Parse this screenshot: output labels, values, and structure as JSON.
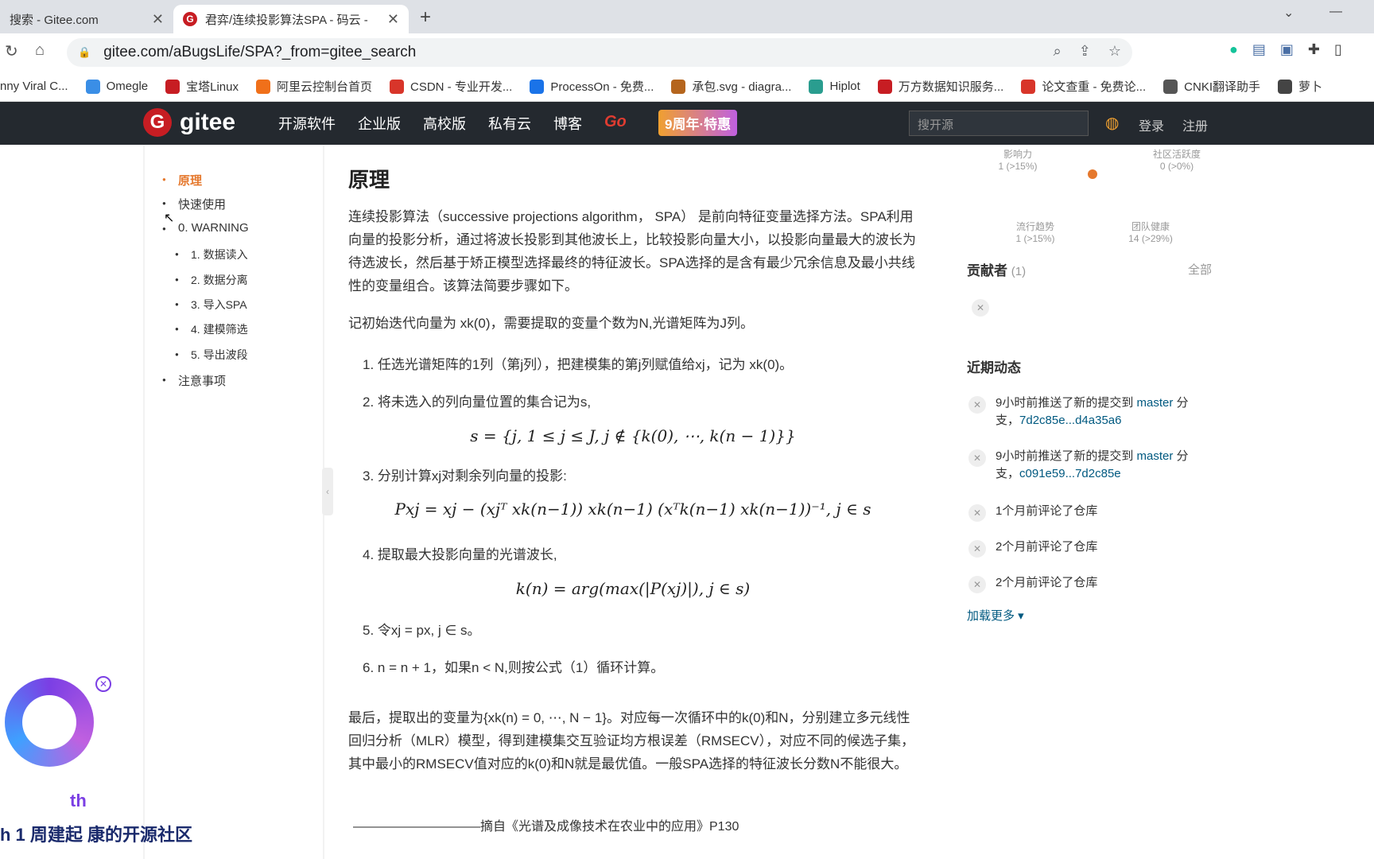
{
  "browser": {
    "tabs": [
      {
        "title": "搜索 - Gitee.com"
      },
      {
        "title": "君弈/连续投影算法SPA - 码云 -"
      }
    ],
    "url": "gitee.com/aBugsLife/SPA?_from=gitee_search",
    "bookmarks": [
      {
        "label": "nny Viral C...",
        "color": "#888"
      },
      {
        "label": "Omegle",
        "color": "#3a8ee6"
      },
      {
        "label": "宝塔Linux",
        "color": "#c71d23"
      },
      {
        "label": "阿里云控制台首页",
        "color": "#f0701a"
      },
      {
        "label": "CSDN - 专业开发...",
        "color": "#d8352a"
      },
      {
        "label": "ProcessOn - 免费...",
        "color": "#1a73e8"
      },
      {
        "label": "承包.svg - diagra...",
        "color": "#b5651d"
      },
      {
        "label": "Hiplot",
        "color": "#2a9d8f"
      },
      {
        "label": "万方数据知识服务...",
        "color": "#c71d23"
      },
      {
        "label": "论文查重 - 免费论...",
        "color": "#d8352a"
      },
      {
        "label": "CNKI翻译助手",
        "color": "#555"
      },
      {
        "label": "萝卜",
        "color": "#444"
      }
    ]
  },
  "gitee_nav": {
    "logo": "gitee",
    "menu": [
      "开源软件",
      "企业版",
      "高校版",
      "私有云",
      "博客"
    ],
    "go": "Go",
    "promo": "9周年·特惠",
    "search_placeholder": "搜开源",
    "login": "登录",
    "register": "注册"
  },
  "toc": {
    "items": [
      {
        "label": "原理",
        "level": 1,
        "active": true
      },
      {
        "label": "快速使用",
        "level": 1
      },
      {
        "label": "0. WARNING",
        "level": 1
      },
      {
        "label": "1. 数据读入",
        "level": 2
      },
      {
        "label": "2. 数据分离",
        "level": 2
      },
      {
        "label": "3. 导入SPA",
        "level": 2
      },
      {
        "label": "4. 建模筛选",
        "level": 2
      },
      {
        "label": "5. 导出波段",
        "level": 2
      },
      {
        "label": "注意事项",
        "level": 1
      }
    ]
  },
  "article": {
    "title": "原理",
    "intro": "连续投影算法（successive projections algorithm， SPA） 是前向特征变量选择方法。SPA利用向量的投影分析，通过将波长投影到其他波长上，比较投影向量大小，以投影向量最大的波长为待选波长，然后基于矫正模型选择最终的特征波长。SPA选择的是含有最少冗余信息及最小共线性的变量组合。该算法简要步骤如下。",
    "init": "记初始迭代向量为 xk(0)，需要提取的变量个数为N,光谱矩阵为J列。",
    "steps": [
      "1. 任选光谱矩阵的1列（第j列），把建模集的第j列赋值给xj，记为 xk(0)。",
      "2. 将未选入的列向量位置的集合记为s,",
      "3. 分别计算xj对剩余列向量的投影:",
      "4. 提取最大投影向量的光谱波长,",
      "5. 令xj = px, j ∈ s。",
      "6. n = n + 1，如果n < N,则按公式（1）循环计算。"
    ],
    "formulas": [
      "s = {j, 1 ≤ j ≤ J, j ∉ {k(0), ⋯, k(n − 1)}}",
      "Pxj = xj − (xjᵀ xk(n−1)) xk(n−1) (xᵀk(n−1) xk(n−1))⁻¹, j ∈ s",
      "k(n) = arg(max(|P(xj)|), j ∈ s)"
    ],
    "conclusion": "最后，提取出的变量为{xk(n) = 0, ⋯, N − 1}。对应每一次循环中的k(0)和N，分别建立多元线性回归分析（MLR）模型，得到建模集交互验证均方根误差（RMSECV），对应不同的候选子集，其中最小的RMSECV值对应的k(0)和N就是最优值。一般SPA选择的特征波长分数N不能很大。",
    "quote": "——————————摘自《光谱及成像技术在农业中的应用》P130"
  },
  "sidebar": {
    "metrics": [
      {
        "name": "影响力",
        "value": "1 (>15%)"
      },
      {
        "name": "社区活跃度",
        "value": "0 (>0%)"
      },
      {
        "name": "流行趋势",
        "value": "1 (>15%)"
      },
      {
        "name": "团队健康",
        "value": "14 (>29%)"
      }
    ],
    "contributors_title": "贡献者",
    "contributors_count": "(1)",
    "all": "全部",
    "activity_title": "近期动态",
    "activities": [
      {
        "prefix": "9小时前推送了新的提交到 ",
        "link": "master",
        "mid": " 分支，",
        "commit": "7d2c85e...d4a35a6"
      },
      {
        "prefix": "9小时前推送了新的提交到 ",
        "link": "master",
        "mid": " 分支，",
        "commit": "c091e59...7d2c85e"
      },
      {
        "prefix": "1个月前评论了仓库",
        "link": "",
        "mid": "",
        "commit": ""
      },
      {
        "prefix": "2个月前评论了仓库",
        "link": "",
        "mid": "",
        "commit": ""
      },
      {
        "prefix": "2个月前评论了仓库",
        "link": "",
        "mid": "",
        "commit": ""
      }
    ],
    "load_more": "加载更多 ▾"
  },
  "ad": {
    "text": "h 1 周建起 康的开源社区",
    "th": "th"
  }
}
